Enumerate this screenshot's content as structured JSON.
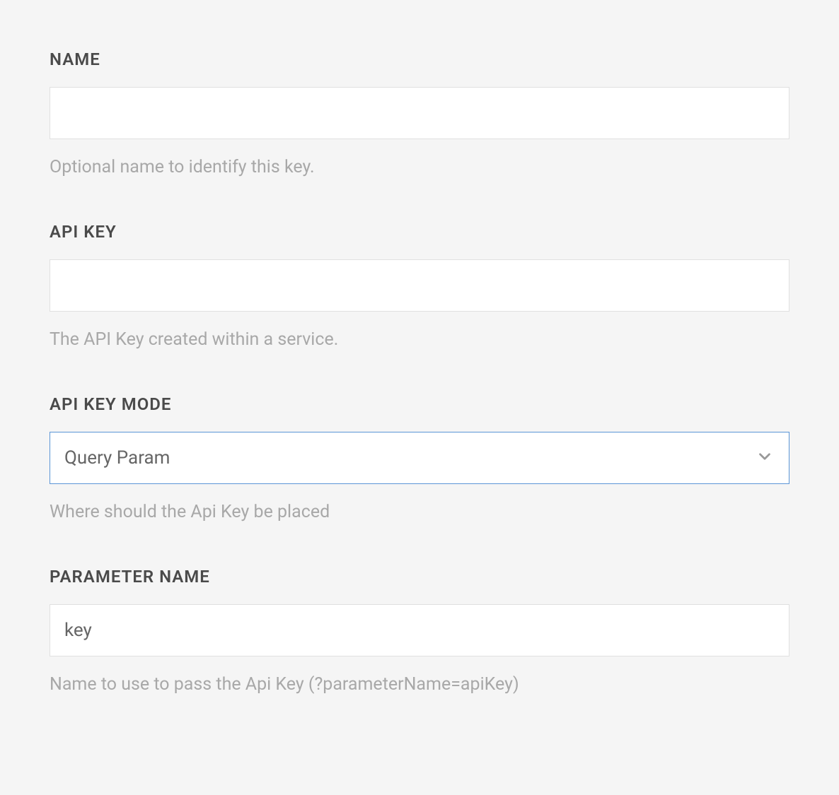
{
  "fields": {
    "name": {
      "label": "NAME",
      "value": "",
      "help": "Optional name to identify this key."
    },
    "apiKey": {
      "label": "API KEY",
      "value": "",
      "help": "The API Key created within a service."
    },
    "apiKeyMode": {
      "label": "API KEY MODE",
      "selected": "Query Param",
      "help": "Where should the Api Key be placed"
    },
    "parameterName": {
      "label": "PARAMETER NAME",
      "value": "key",
      "help": "Name to use to pass the Api Key (?parameterName=apiKey)"
    }
  }
}
